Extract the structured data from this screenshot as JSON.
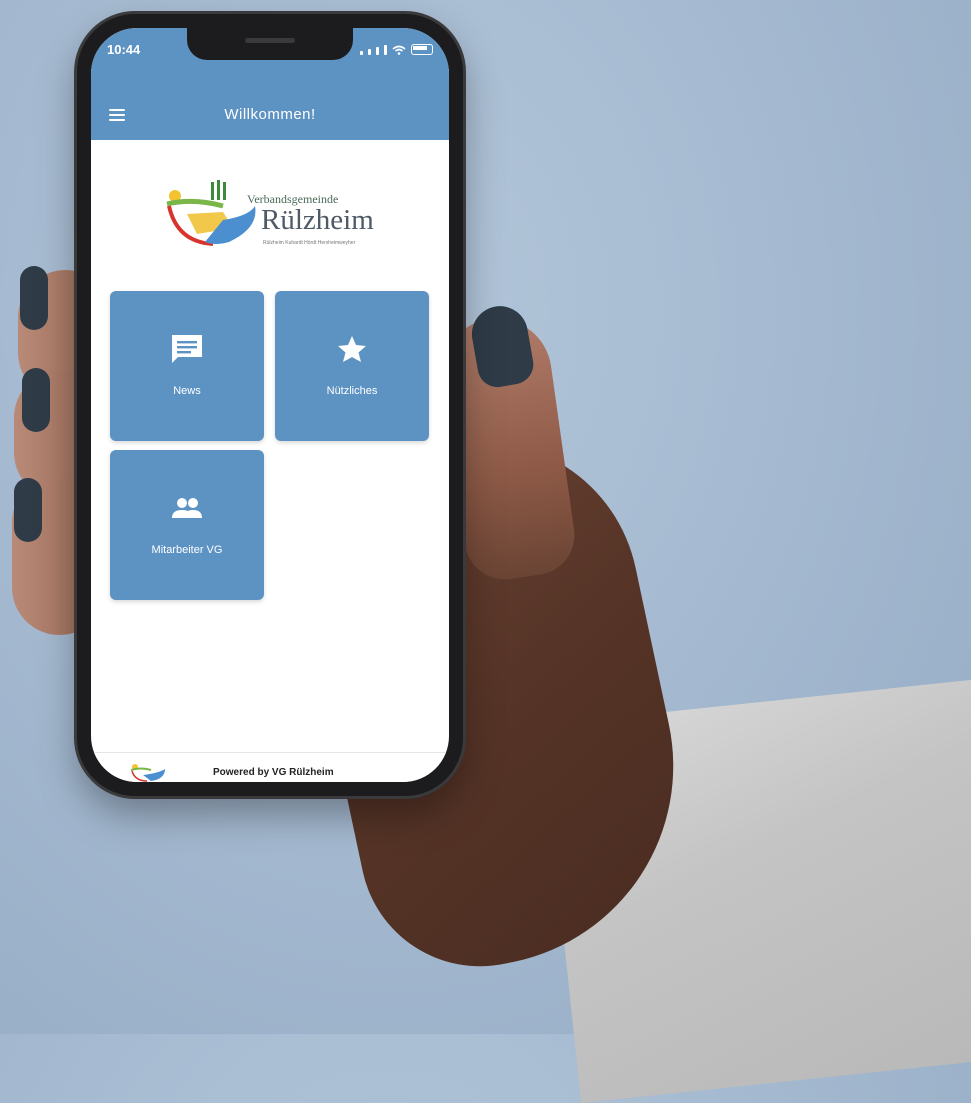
{
  "status_bar": {
    "time": "10:44"
  },
  "app_bar": {
    "title": "Willkommen!",
    "menu_icon": "hamburger-menu-icon"
  },
  "logo": {
    "line1": "Verbandsgemeinde",
    "line2": "Rülzheim",
    "line3": "Rülzheim Kuhardt Hördt Herxheimweyher"
  },
  "tiles": [
    {
      "label": "News",
      "icon": "chat-message-icon"
    },
    {
      "label": "Nützliches",
      "icon": "star-icon"
    },
    {
      "label": "Mitarbeiter VG",
      "icon": "people-icon"
    }
  ],
  "footer": {
    "text": "Powered by VG Rülzheim"
  },
  "colors": {
    "primary": "#5d93c3",
    "background": "#a9bdd3"
  }
}
